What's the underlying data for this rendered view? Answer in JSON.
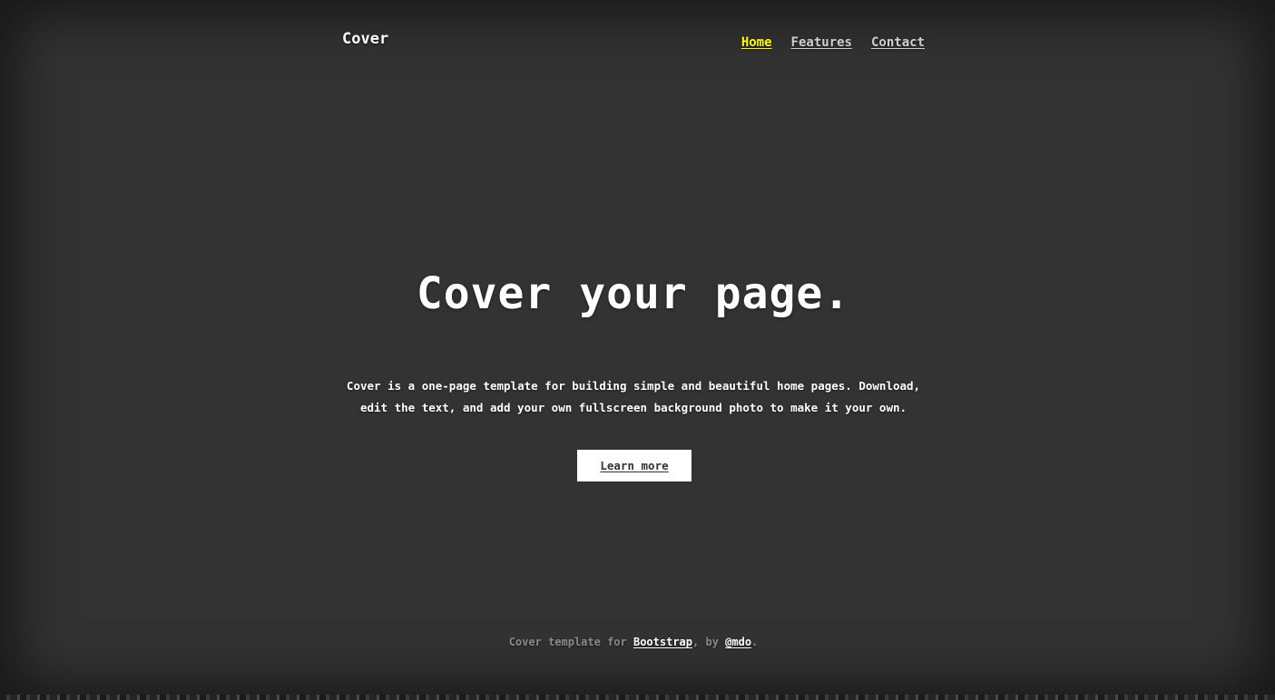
{
  "header": {
    "brand": "Cover",
    "nav": [
      {
        "label": "Home",
        "active": true
      },
      {
        "label": "Features",
        "active": false
      },
      {
        "label": "Contact",
        "active": false
      }
    ]
  },
  "hero": {
    "title": "Cover your page.",
    "lead": "Cover is a one-page template for building simple and beautiful home pages. Download, edit the text, and add your own fullscreen background photo to make it your own.",
    "button_label": "Learn more"
  },
  "footer": {
    "prefix": "Cover template for ",
    "link1": "Bootstrap",
    "middle": ", by ",
    "link2": "@mdo",
    "suffix": "."
  },
  "colors": {
    "background": "#333333",
    "active_nav": "#ffff00",
    "text": "#ffffff",
    "muted": "#8a8a8a"
  }
}
